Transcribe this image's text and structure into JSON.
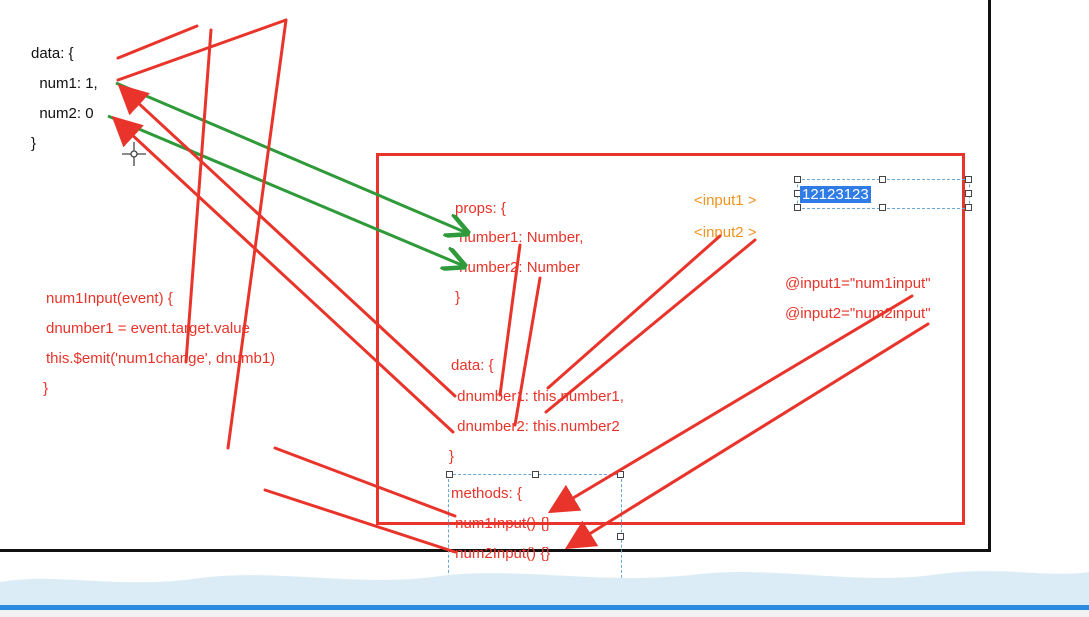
{
  "colors": {
    "annotation_red": "#e8342a",
    "arrow_green": "#2e9a3a",
    "text_orange": "#f0921e",
    "selection_blue": "#2f7ce6",
    "frame_black": "#111111",
    "band_blue": "#2a8be0"
  },
  "parent": {
    "lines": [
      "data: {",
      "  num1: 1,",
      "  num2: 0",
      "}"
    ]
  },
  "handler": {
    "lines": [
      "num1Input(event) {",
      "dnumber1 = event.target.value",
      "this.$emit('num1change', dnumb1)",
      " }"
    ]
  },
  "child": {
    "props": [
      "props: {",
      " number1: Number,",
      " number2: Number",
      " }"
    ],
    "data": [
      "data: {",
      " dnumber1: this.number1,",
      " dnumber2: this.number2",
      "}"
    ],
    "methods": [
      "methods: {",
      " num1Input() {}",
      " num2Input() {}",
      "},",
      "}"
    ],
    "inputs": [
      "<input1 >",
      "<input2 >"
    ],
    "selected_value": "12123123",
    "events": [
      "@input1=\"num1input\"",
      "@input2=\"num2input\""
    ]
  }
}
